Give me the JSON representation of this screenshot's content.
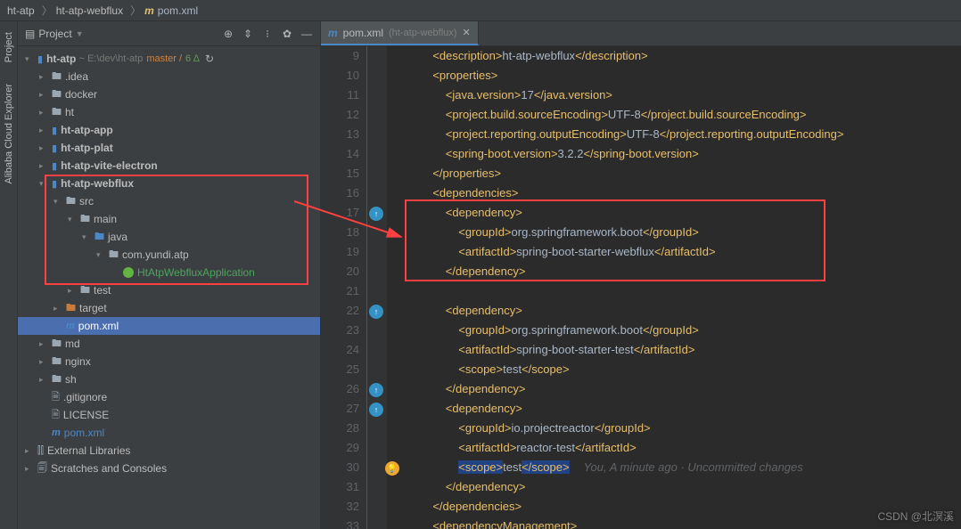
{
  "breadcrumbs": {
    "c1": "ht-atp",
    "c2": "ht-atp-webflux",
    "c3": "pom.xml",
    "icon": "m"
  },
  "panel": {
    "title": "Project"
  },
  "leftbar": {
    "l1": "Project",
    "l2": "Alibaba Cloud Explorer"
  },
  "tree": {
    "root": {
      "name": "ht-atp",
      "path": "E:\\dev\\ht-atp",
      "branch": "master /",
      "changes": "6 Δ"
    },
    "idea": ".idea",
    "docker": "docker",
    "ht": "ht",
    "htatpapp": "ht-atp-app",
    "htatpplat": "ht-atp-plat",
    "htatpvite": "ht-atp-vite-electron",
    "htatpwebflux": "ht-atp-webflux",
    "src": "src",
    "main": "main",
    "java": "java",
    "pkg": "com.yundi.atp",
    "app": "HtAtpWebfluxApplication",
    "test": "test",
    "target": "target",
    "pom": "pom.xml",
    "md": "md",
    "nginx": "nginx",
    "sh": "sh",
    "gitignore": ".gitignore",
    "license": "LICENSE",
    "pom2": "pom.xml",
    "extlib": "External Libraries",
    "scratches": "Scratches and Consoles"
  },
  "tab": {
    "file": "pom.xml",
    "context": "(ht-atp-webflux)",
    "icon": "m"
  },
  "code": {
    "lines": [
      "9",
      "10",
      "11",
      "12",
      "13",
      "14",
      "15",
      "16",
      "17",
      "18",
      "19",
      "20",
      "21",
      "22",
      "23",
      "24",
      "25",
      "26",
      "27",
      "28",
      "29",
      "30",
      "31",
      "32",
      "33"
    ],
    "l9a": "<description>",
    "l9b": "ht-atp-webflux",
    "l9c": "</description>",
    "l10a": "<properties>",
    "l11a": "<java.version>",
    "l11b": "17",
    "l11c": "</java.version>",
    "l12a": "<project.build.sourceEncoding>",
    "l12b": "UTF-8",
    "l12c": "</project.build.sourceEncoding>",
    "l13a": "<project.reporting.outputEncoding>",
    "l13b": "UTF-8",
    "l13c": "</project.reporting.outputEncoding>",
    "l14a": "<spring-boot.version>",
    "l14b": "3.2.2",
    "l14c": "</spring-boot.version>",
    "l15a": "</properties>",
    "l16a": "<dependencies>",
    "l17a": "<dependency>",
    "l18a": "<groupId>",
    "l18b": "org.springframework.boot",
    "l18c": "</groupId>",
    "l19a": "<artifactId>",
    "l19b": "spring-boot-starter-webflux",
    "l19c": "</artifactId>",
    "l20a": "</dependency>",
    "l22a": "<dependency>",
    "l23a": "<groupId>",
    "l23b": "org.springframework.boot",
    "l23c": "</groupId>",
    "l24a": "<artifactId>",
    "l24b": "spring-boot-starter-test",
    "l24c": "</artifactId>",
    "l25a": "<scope>",
    "l25b": "test",
    "l25c": "</scope>",
    "l26a": "</dependency>",
    "l27a": "<dependency>",
    "l28a": "<groupId>",
    "l28b": "io.projectreactor",
    "l28c": "</groupId>",
    "l29a": "<artifactId>",
    "l29b": "reactor-test",
    "l29c": "</artifactId>",
    "l30a": "<scope>",
    "l30b": "test",
    "l30c": "</scope>",
    "l30inlay": "You, A minute ago · Uncommitted changes",
    "l31a": "</dependency>",
    "l32a": "</dependencies>",
    "l33a": "<dependencyManagement>"
  },
  "watermark": "CSDN @北溟溪"
}
